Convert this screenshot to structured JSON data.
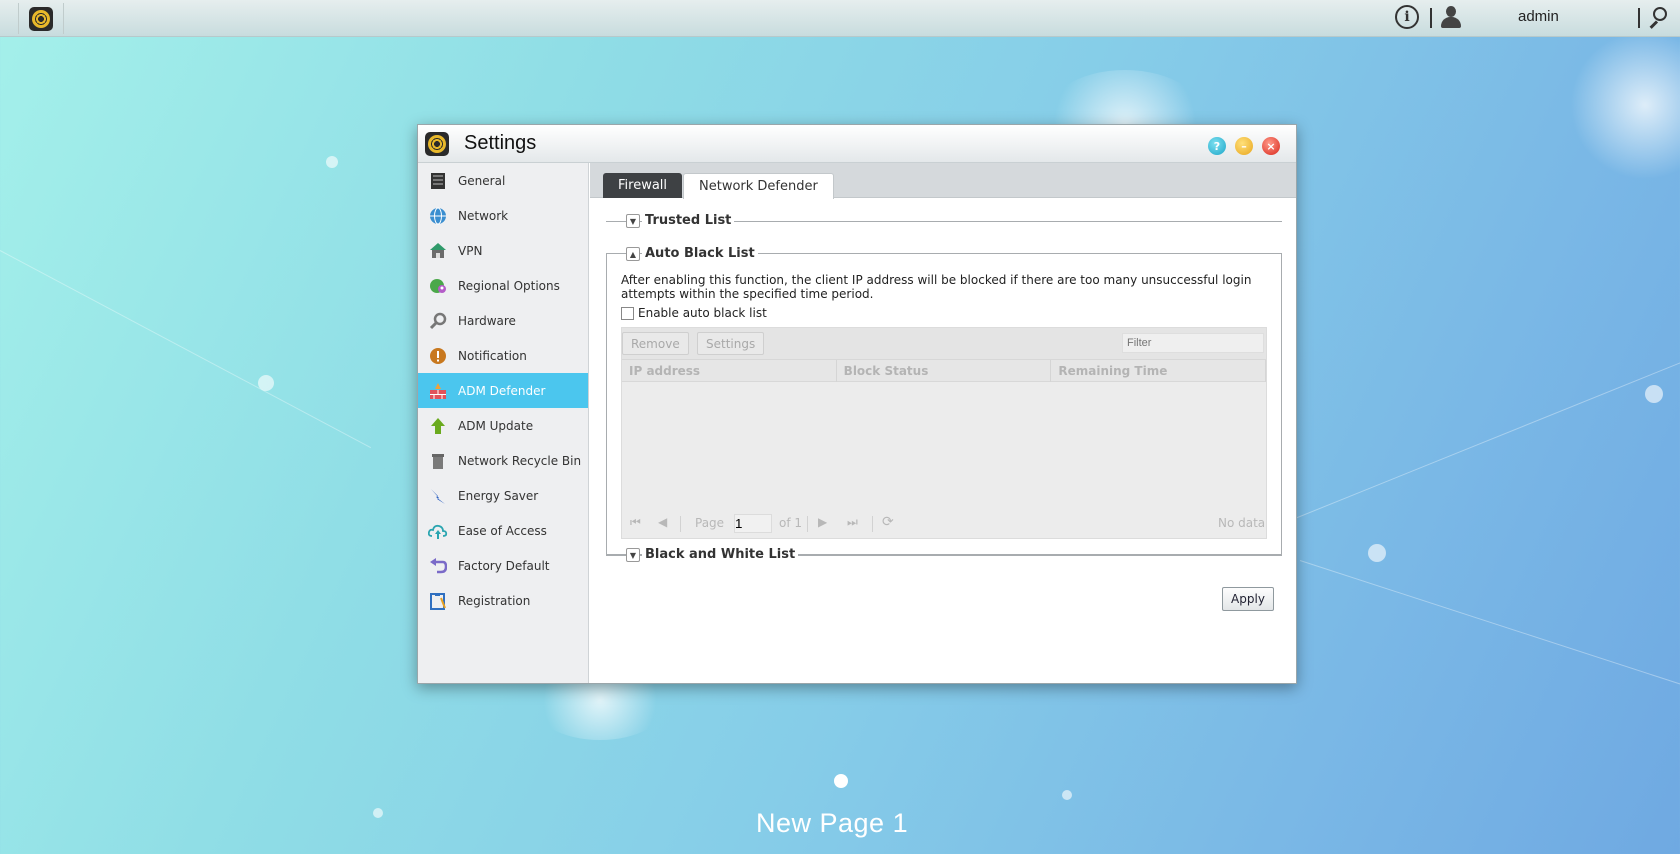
{
  "topbar": {
    "username": "admin",
    "info_glyph": "i",
    "icons": [
      "adm-logo-icon",
      "info-icon",
      "user-icon",
      "search-icon"
    ]
  },
  "window": {
    "title": "Settings",
    "controls": [
      "help-icon",
      "minimize-icon",
      "close-icon"
    ]
  },
  "sidebar": {
    "items": [
      {
        "label": "General",
        "icon": "server-icon"
      },
      {
        "label": "Network",
        "icon": "globe-icon"
      },
      {
        "label": "VPN",
        "icon": "vpn-house-icon"
      },
      {
        "label": "Regional Options",
        "icon": "location-globe-icon"
      },
      {
        "label": "Hardware",
        "icon": "wrench-icon"
      },
      {
        "label": "Notification",
        "icon": "alert-icon"
      },
      {
        "label": "ADM Defender",
        "icon": "firewall-icon"
      },
      {
        "label": "ADM Update",
        "icon": "arrow-up-icon"
      },
      {
        "label": "Network Recycle Bin",
        "icon": "trash-icon"
      },
      {
        "label": "Energy Saver",
        "icon": "lightning-icon"
      },
      {
        "label": "Ease of Access",
        "icon": "cloud-upload-icon"
      },
      {
        "label": "Factory Default",
        "icon": "undo-arrow-icon"
      },
      {
        "label": "Registration",
        "icon": "clipboard-icon"
      }
    ],
    "active_index": 6,
    "active_color": "#4bc6ee"
  },
  "tabs": [
    {
      "label": "Firewall",
      "selected": false
    },
    {
      "label": "Network Defender",
      "selected": true
    }
  ],
  "sections": {
    "trusted_list": {
      "title": "Trusted List",
      "expanded": false
    },
    "auto_black_list": {
      "title": "Auto Black List",
      "expanded": true,
      "description": "After enabling this function, the client IP address will be blocked if there are too many unsuccessful login attempts within the specified time period.",
      "checkbox_label": "Enable auto black list",
      "checkbox_checked": false
    },
    "black_white_list": {
      "title": "Black and White List",
      "expanded": false
    }
  },
  "grid": {
    "buttons": {
      "remove": "Remove",
      "settings": "Settings"
    },
    "filter_placeholder": "Filter",
    "columns": [
      "IP address",
      "Block Status",
      "Remaining Time"
    ],
    "rows": [],
    "pager": {
      "page_label": "Page",
      "page_value": "1",
      "of_label": "of 1",
      "status": "No data"
    }
  },
  "actions": {
    "apply": "Apply"
  },
  "desktop": {
    "page_label": "New Page 1"
  }
}
